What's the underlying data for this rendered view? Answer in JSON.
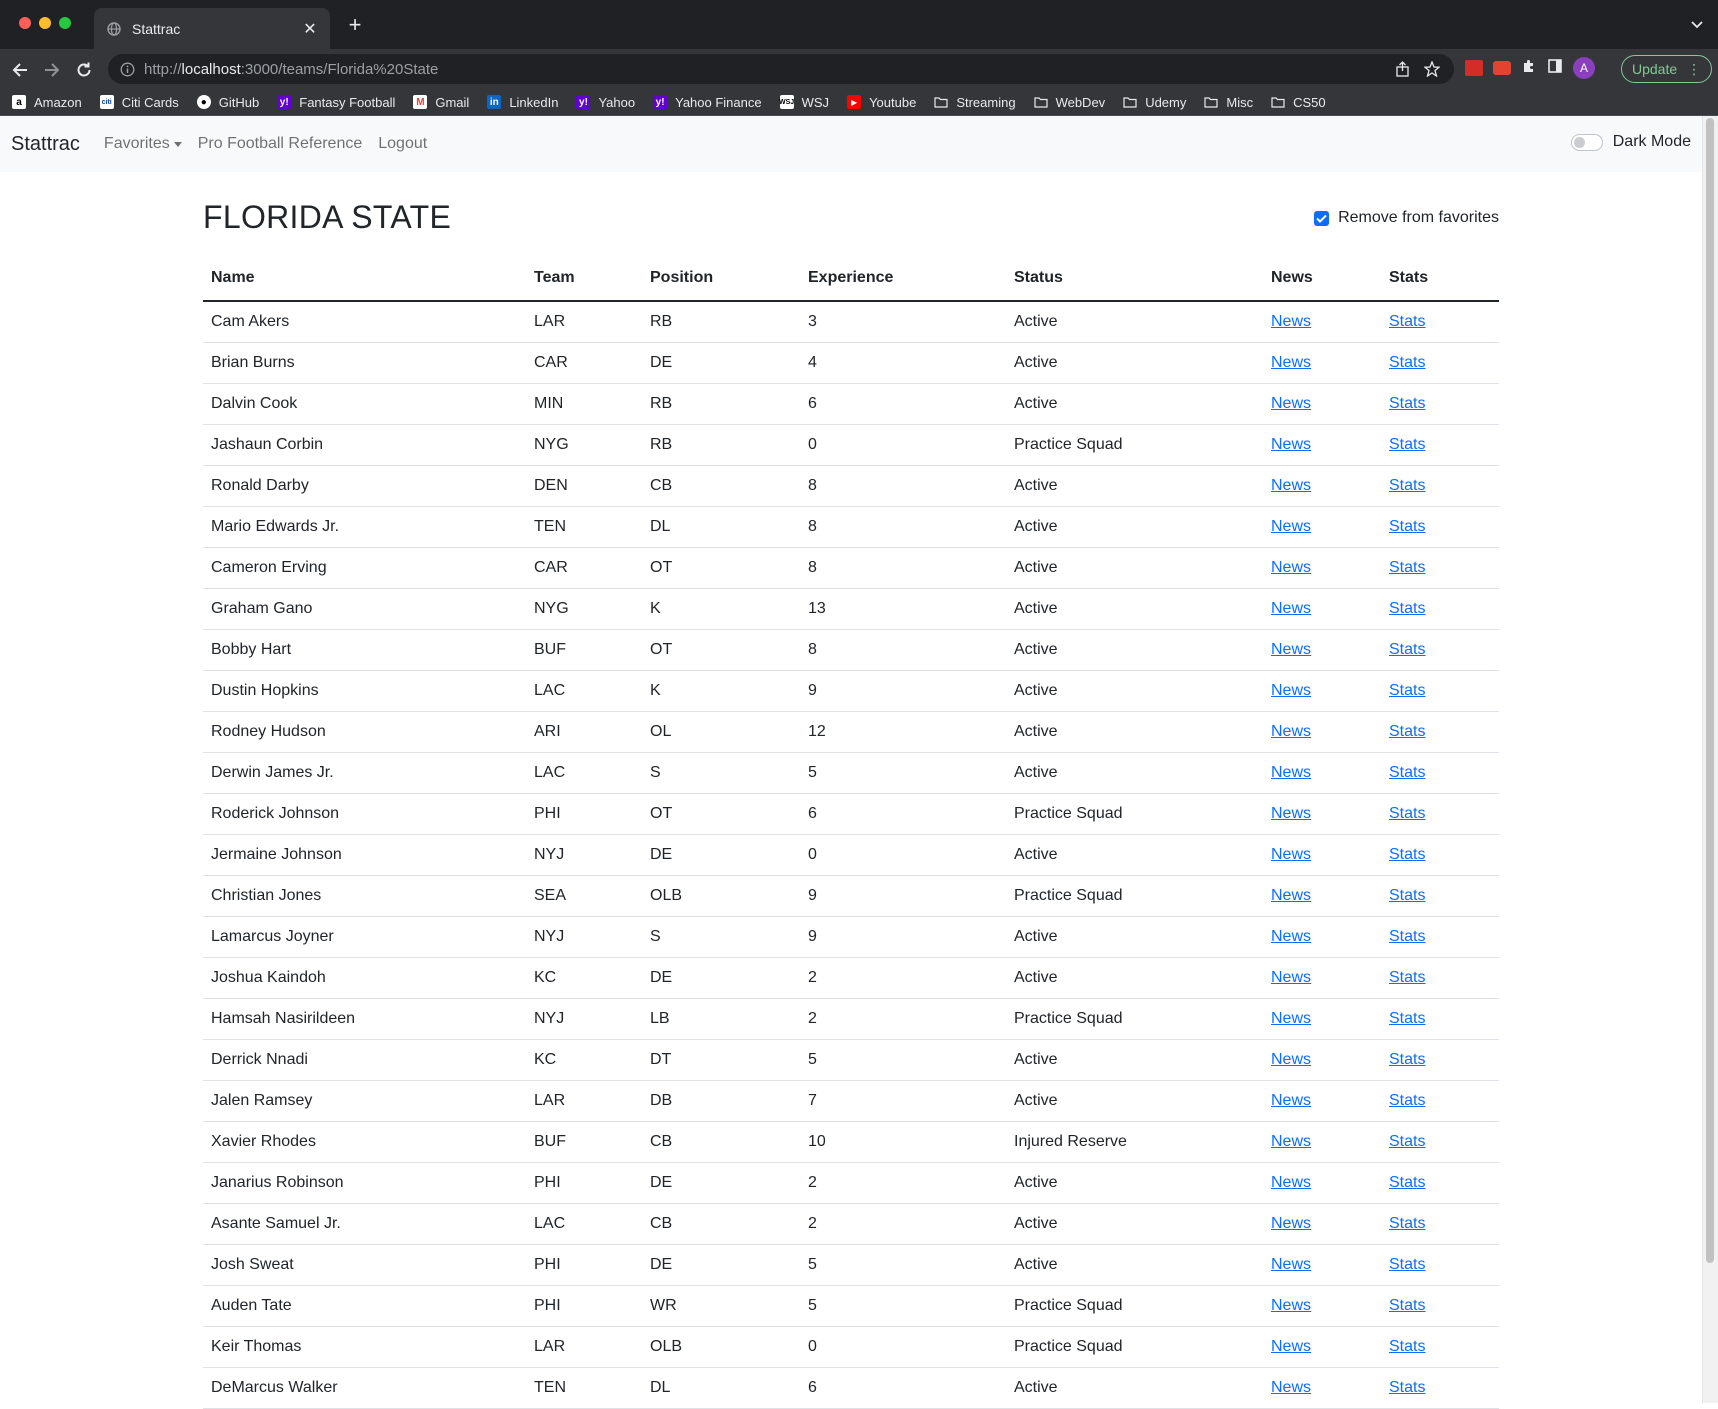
{
  "browser": {
    "tab_title": "Stattrac",
    "url_prefix": "http://",
    "url_host": "localhost",
    "url_rest": ":3000/teams/Florida%20State",
    "avatar_letter": "A",
    "update_label": "Update"
  },
  "bookmarks": [
    {
      "label": "Amazon",
      "icon": "amazon-icon"
    },
    {
      "label": "Citi Cards",
      "icon": "citi-icon"
    },
    {
      "label": "GitHub",
      "icon": "github-icon"
    },
    {
      "label": "Fantasy Football",
      "icon": "yahoo-icon"
    },
    {
      "label": "Gmail",
      "icon": "gmail-icon"
    },
    {
      "label": "LinkedIn",
      "icon": "linkedin-icon"
    },
    {
      "label": "Yahoo",
      "icon": "yahoo-icon"
    },
    {
      "label": "Yahoo Finance",
      "icon": "yahoo-icon"
    },
    {
      "label": "WSJ",
      "icon": "wsj-icon"
    },
    {
      "label": "Youtube",
      "icon": "youtube-icon"
    },
    {
      "label": "Streaming",
      "icon": "folder-icon"
    },
    {
      "label": "WebDev",
      "icon": "folder-icon"
    },
    {
      "label": "Udemy",
      "icon": "folder-icon"
    },
    {
      "label": "Misc",
      "icon": "folder-icon"
    },
    {
      "label": "CS50",
      "icon": "folder-icon"
    }
  ],
  "navbar": {
    "brand": "Stattrac",
    "favorites": "Favorites",
    "pfr": "Pro Football Reference",
    "logout": "Logout",
    "dark_mode": "Dark Mode"
  },
  "page": {
    "title": "FLORIDA STATE",
    "favorite_label": "Remove from favorites",
    "favorite_checked": true
  },
  "table": {
    "headers": [
      "Name",
      "Team",
      "Position",
      "Experience",
      "Status",
      "News",
      "Stats"
    ],
    "rows": [
      [
        "Cam Akers",
        "LAR",
        "RB",
        "3",
        "Active",
        "News",
        "Stats"
      ],
      [
        "Brian Burns",
        "CAR",
        "DE",
        "4",
        "Active",
        "News",
        "Stats"
      ],
      [
        "Dalvin Cook",
        "MIN",
        "RB",
        "6",
        "Active",
        "News",
        "Stats"
      ],
      [
        "Jashaun Corbin",
        "NYG",
        "RB",
        "0",
        "Practice Squad",
        "News",
        "Stats"
      ],
      [
        "Ronald Darby",
        "DEN",
        "CB",
        "8",
        "Active",
        "News",
        "Stats"
      ],
      [
        "Mario Edwards Jr.",
        "TEN",
        "DL",
        "8",
        "Active",
        "News",
        "Stats"
      ],
      [
        "Cameron Erving",
        "CAR",
        "OT",
        "8",
        "Active",
        "News",
        "Stats"
      ],
      [
        "Graham Gano",
        "NYG",
        "K",
        "13",
        "Active",
        "News",
        "Stats"
      ],
      [
        "Bobby Hart",
        "BUF",
        "OT",
        "8",
        "Active",
        "News",
        "Stats"
      ],
      [
        "Dustin Hopkins",
        "LAC",
        "K",
        "9",
        "Active",
        "News",
        "Stats"
      ],
      [
        "Rodney Hudson",
        "ARI",
        "OL",
        "12",
        "Active",
        "News",
        "Stats"
      ],
      [
        "Derwin James Jr.",
        "LAC",
        "S",
        "5",
        "Active",
        "News",
        "Stats"
      ],
      [
        "Roderick Johnson",
        "PHI",
        "OT",
        "6",
        "Practice Squad",
        "News",
        "Stats"
      ],
      [
        "Jermaine Johnson",
        "NYJ",
        "DE",
        "0",
        "Active",
        "News",
        "Stats"
      ],
      [
        "Christian Jones",
        "SEA",
        "OLB",
        "9",
        "Practice Squad",
        "News",
        "Stats"
      ],
      [
        "Lamarcus Joyner",
        "NYJ",
        "S",
        "9",
        "Active",
        "News",
        "Stats"
      ],
      [
        "Joshua Kaindoh",
        "KC",
        "DE",
        "2",
        "Active",
        "News",
        "Stats"
      ],
      [
        "Hamsah Nasirildeen",
        "NYJ",
        "LB",
        "2",
        "Practice Squad",
        "News",
        "Stats"
      ],
      [
        "Derrick Nnadi",
        "KC",
        "DT",
        "5",
        "Active",
        "News",
        "Stats"
      ],
      [
        "Jalen Ramsey",
        "LAR",
        "DB",
        "7",
        "Active",
        "News",
        "Stats"
      ],
      [
        "Xavier Rhodes",
        "BUF",
        "CB",
        "10",
        "Injured Reserve",
        "News",
        "Stats"
      ],
      [
        "Janarius Robinson",
        "PHI",
        "DE",
        "2",
        "Active",
        "News",
        "Stats"
      ],
      [
        "Asante Samuel Jr.",
        "LAC",
        "CB",
        "2",
        "Active",
        "News",
        "Stats"
      ],
      [
        "Josh Sweat",
        "PHI",
        "DE",
        "5",
        "Active",
        "News",
        "Stats"
      ],
      [
        "Auden Tate",
        "PHI",
        "WR",
        "5",
        "Practice Squad",
        "News",
        "Stats"
      ],
      [
        "Keir Thomas",
        "LAR",
        "OLB",
        "0",
        "Practice Squad",
        "News",
        "Stats"
      ],
      [
        "DeMarcus Walker",
        "TEN",
        "DL",
        "6",
        "Active",
        "News",
        "Stats"
      ]
    ]
  },
  "colors": {
    "link": "#0d6efd",
    "checkbox": "#0d6efd",
    "navbar_bg": "#f8f9fa",
    "chrome_bg": "#202124"
  }
}
